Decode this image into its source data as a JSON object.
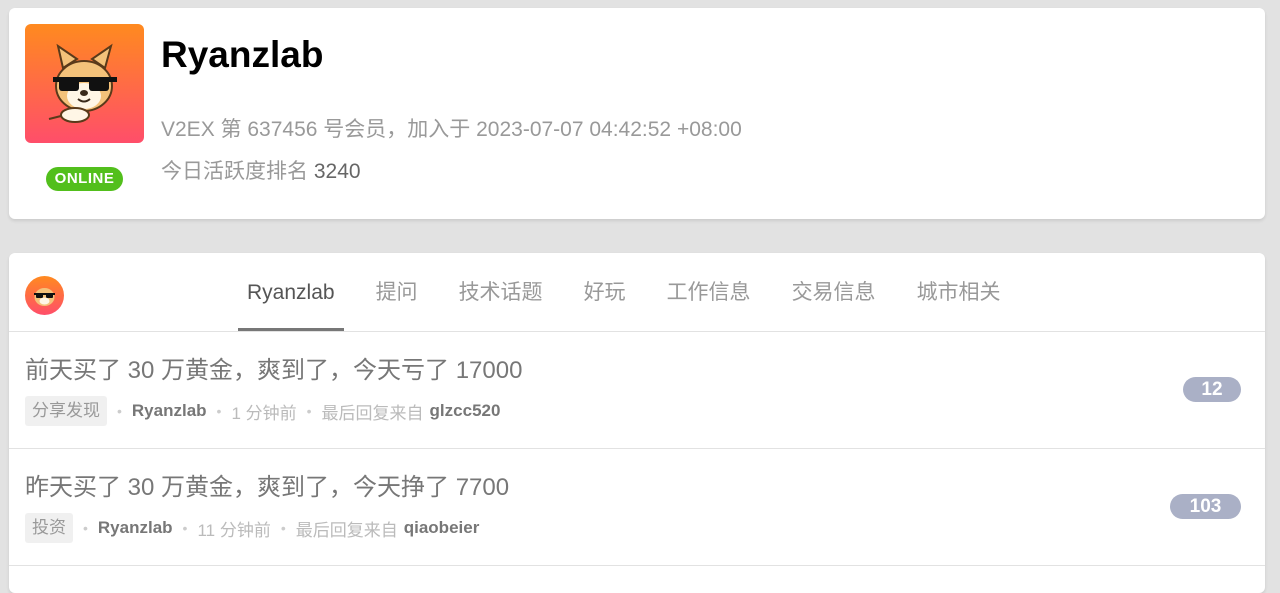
{
  "profile": {
    "username": "Ryanzlab",
    "online_label": "ONLINE",
    "member_line": "V2EX 第 637456 号会员，加入于 2023-07-07 04:42:52 +08:00",
    "rank_label": "今日活跃度排名",
    "rank_value": "3240",
    "avatar_icon": "shiba-dog-sunglasses-avatar"
  },
  "tabs": [
    "Ryanzlab",
    "提问",
    "技术话题",
    "好玩",
    "工作信息",
    "交易信息",
    "城市相关"
  ],
  "active_tab": "Ryanzlab",
  "topics": [
    {
      "title": "前天买了 30 万黄金，爽到了，今天亏了 17000",
      "node": "分享发现",
      "author": "Ryanzlab",
      "time": "1 分钟前",
      "last_reply_label": "最后回复来自",
      "last_reply_user": "glzcc520",
      "reply_count": "12"
    },
    {
      "title": "昨天买了 30 万黄金，爽到了，今天挣了 7700",
      "node": "投资",
      "author": "Ryanzlab",
      "time": "11 分钟前",
      "last_reply_label": "最后回复来自",
      "last_reply_user": "qiaobeier",
      "reply_count": "103"
    }
  ],
  "separator": "•",
  "colors": {
    "online_badge": "#52bf1c",
    "reply_count_bg": "#aab0c6",
    "avatar_gradient_top": "#ff8a1f",
    "avatar_gradient_bottom": "#ff4e6a"
  }
}
